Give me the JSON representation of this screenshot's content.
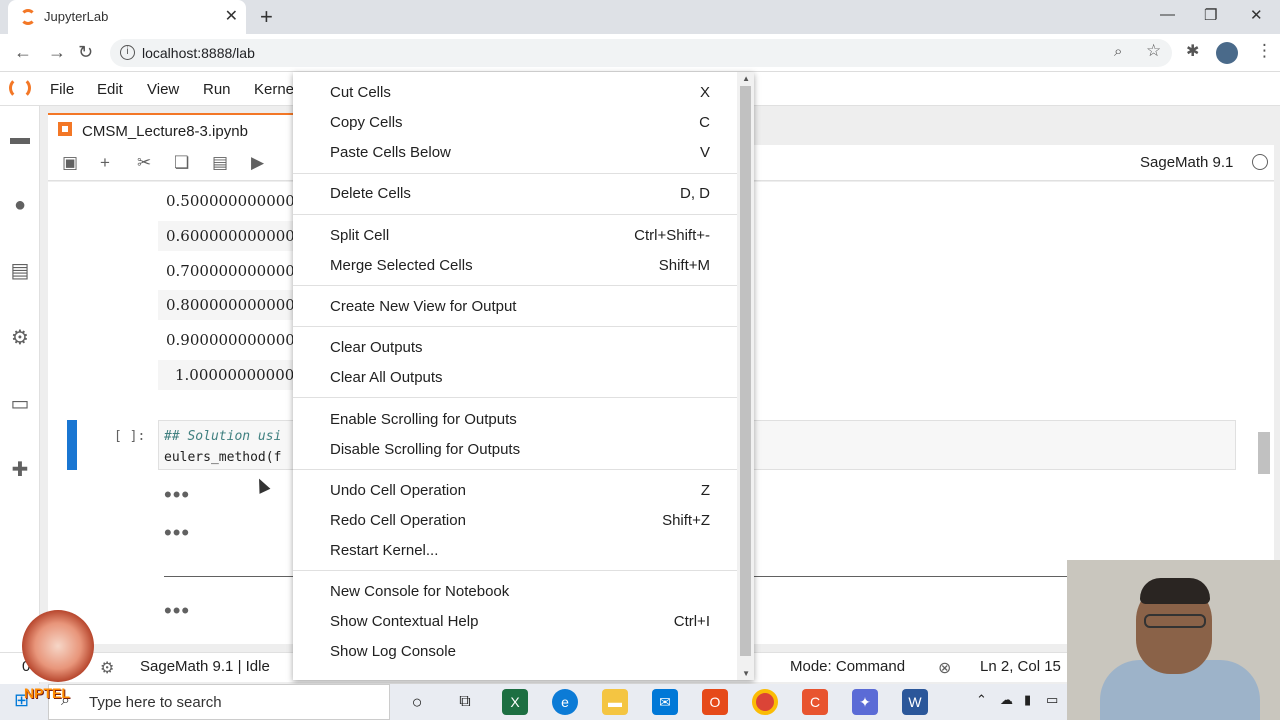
{
  "browser": {
    "tab_title": "JupyterLab",
    "url": "localhost:8888/lab"
  },
  "menubar": {
    "items": [
      "File",
      "Edit",
      "View",
      "Run",
      "Kerne"
    ]
  },
  "notebook": {
    "tab_name": "CMSM_Lecture8-3.ipynb",
    "kernel_name": "SageMath 9.1",
    "outputs": [
      "0.500000000000000",
      "0.600000000000000",
      "0.700000000000000",
      "0.800000000000000",
      "0.900000000000000",
      "1.00000000000000"
    ],
    "cell_prompt": "[ ]:",
    "code_line1": "## Solution usi",
    "code_line2": "eulers_method(f"
  },
  "context_menu": {
    "items": [
      {
        "label": "Cut Cells",
        "shortcut": "X"
      },
      {
        "label": "Copy Cells",
        "shortcut": "C"
      },
      {
        "label": "Paste Cells Below",
        "shortcut": "V"
      },
      {
        "label": "Delete Cells",
        "shortcut": "D, D"
      },
      {
        "label": "Split Cell",
        "shortcut": "Ctrl+Shift+-"
      },
      {
        "label": "Merge Selected Cells",
        "shortcut": "Shift+M"
      },
      {
        "label": "Create New View for Output",
        "shortcut": ""
      },
      {
        "label": "Clear Outputs",
        "shortcut": ""
      },
      {
        "label": "Clear All Outputs",
        "shortcut": ""
      },
      {
        "label": "Enable Scrolling for Outputs",
        "shortcut": ""
      },
      {
        "label": "Disable Scrolling for Outputs",
        "shortcut": ""
      },
      {
        "label": "Undo Cell Operation",
        "shortcut": "Z"
      },
      {
        "label": "Redo Cell Operation",
        "shortcut": "Shift+Z"
      },
      {
        "label": "Restart Kernel...",
        "shortcut": ""
      },
      {
        "label": "New Console for Notebook",
        "shortcut": ""
      },
      {
        "label": "Show Contextual Help",
        "shortcut": "Ctrl+I"
      },
      {
        "label": "Show Log Console",
        "shortcut": ""
      }
    ]
  },
  "statusbar": {
    "left_count": "0",
    "kernel_status": "SageMath 9.1 | Idle",
    "mode": "Mode: Command",
    "position": "Ln 2, Col 15"
  },
  "taskbar": {
    "search_placeholder": "Type here to search"
  },
  "overlay": {
    "logo_text": "NPTEL"
  },
  "colors": {
    "jupyter_orange": "#f37726",
    "active_cell": "#1976d2"
  }
}
